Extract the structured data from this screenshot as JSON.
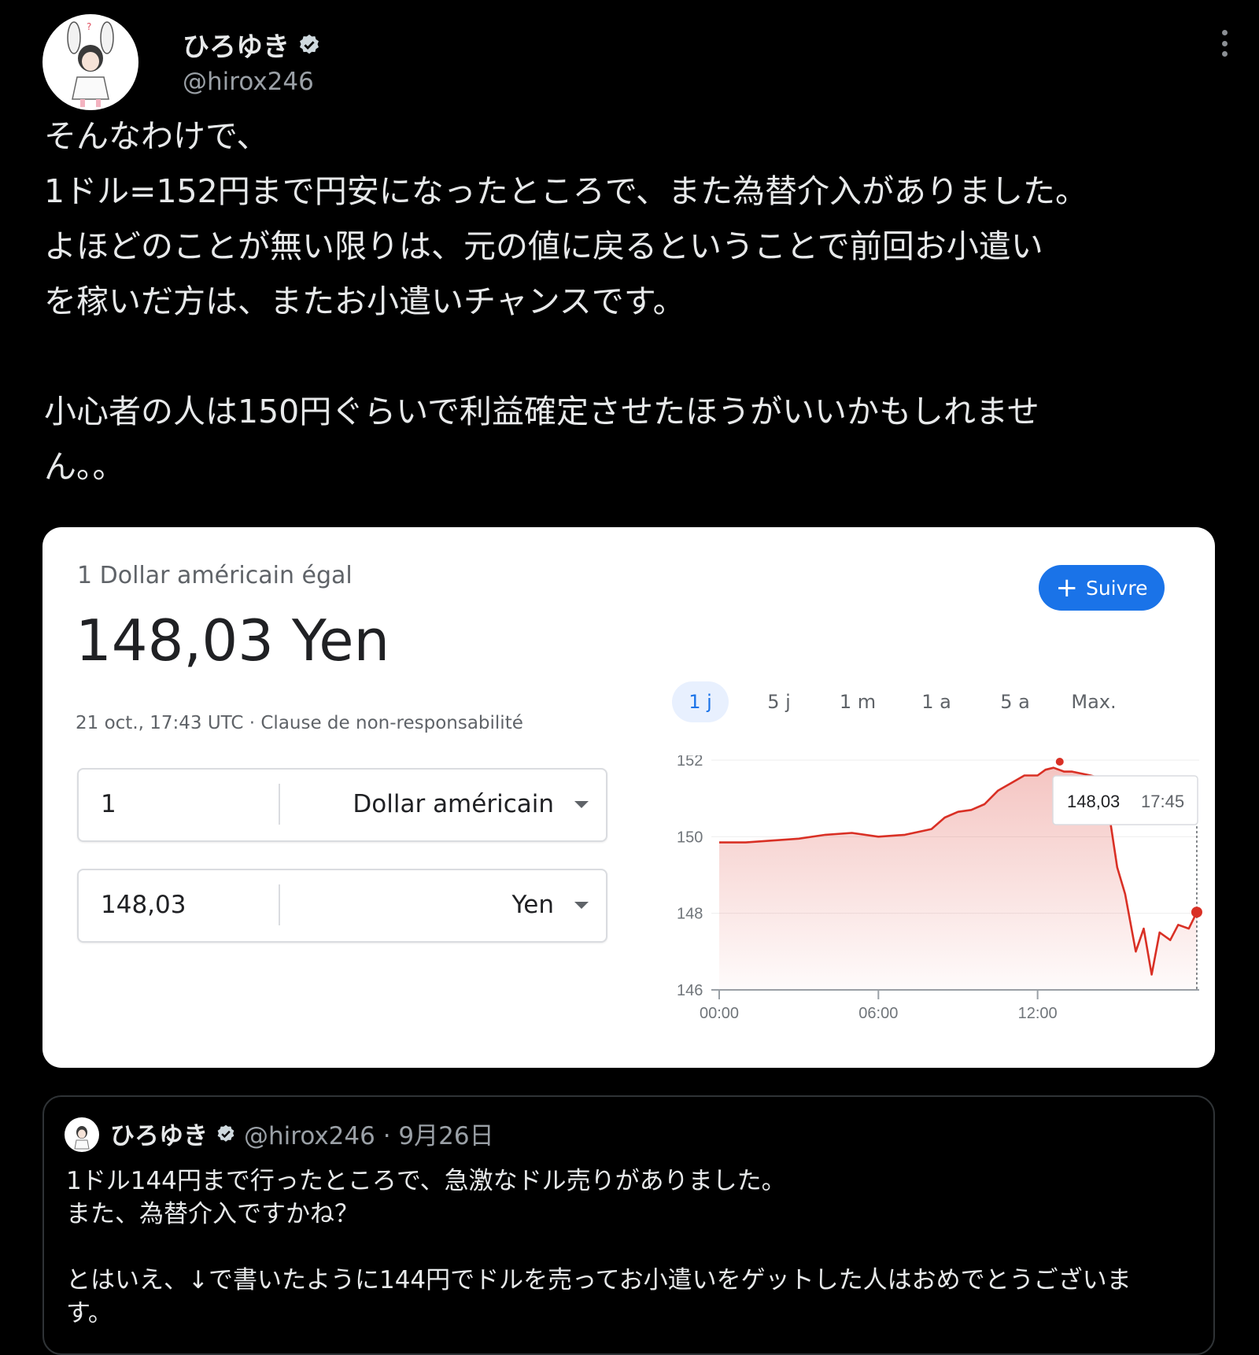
{
  "tweet": {
    "author_name": "ひろゆき",
    "handle": "@hirox246",
    "text": "そんなわけで、\n1ドル=152円まで円安になったところで、また為替介入がありました。\nよほどのことが無い限りは、元の値に戻るということで前回お小遣い\nを稼いだ方は、またお小遣いチャンスです。\n\n小心者の人は150円ぐらいで利益確定させたほうがいいかもしれませ\nん。。"
  },
  "card": {
    "label": "1 Dollar américain égal",
    "value": "148,03 Yen",
    "date": "21 oct., 17:43 UTC · Clause de non-responsabilité",
    "follow_label": "Suivre",
    "ranges": [
      "1 j",
      "5 j",
      "1 m",
      "1 a",
      "5 a",
      "Max."
    ],
    "active_range": "1 j",
    "converter": [
      {
        "amount": "1",
        "currency": "Dollar américain"
      },
      {
        "amount": "148,03",
        "currency": "Yen"
      }
    ],
    "tooltip": {
      "value": "148,03",
      "time": "17:45"
    }
  },
  "chart_data": {
    "type": "area",
    "x_ticks": [
      "00:00",
      "06:00",
      "12:00"
    ],
    "y_ticks": [
      "152",
      "150",
      "148",
      "146"
    ],
    "ylim": [
      146,
      152
    ],
    "color": "#d93025",
    "x": [
      0,
      1,
      2,
      3,
      4,
      5,
      6,
      7,
      8,
      8.5,
      9,
      9.5,
      10,
      10.5,
      11,
      11.5,
      12,
      12.3,
      12.6,
      13,
      13.3,
      14,
      14.5,
      15,
      15.3,
      15.7,
      16,
      16.3,
      16.6,
      17,
      17.3,
      17.7,
      18
    ],
    "y": [
      149.85,
      149.85,
      149.9,
      149.95,
      150.05,
      150.1,
      150.0,
      150.05,
      150.2,
      150.5,
      150.65,
      150.7,
      150.85,
      151.2,
      151.4,
      151.6,
      151.6,
      151.75,
      151.8,
      151.7,
      151.7,
      151.6,
      151.5,
      149.2,
      148.5,
      147.0,
      147.6,
      146.4,
      147.5,
      147.3,
      147.7,
      147.6,
      148.03
    ]
  },
  "quote": {
    "author_name": "ひろゆき",
    "handle_date": "@hirox246 · 9月26日",
    "text": "1ドル144円まで行ったところで、急激なドル売りがありました。\nまた、為替介入ですかね？\n\nとはいえ、↓で書いたように144円でドルを売ってお小遣いをゲットした人はおめでとうございま\nす。"
  }
}
